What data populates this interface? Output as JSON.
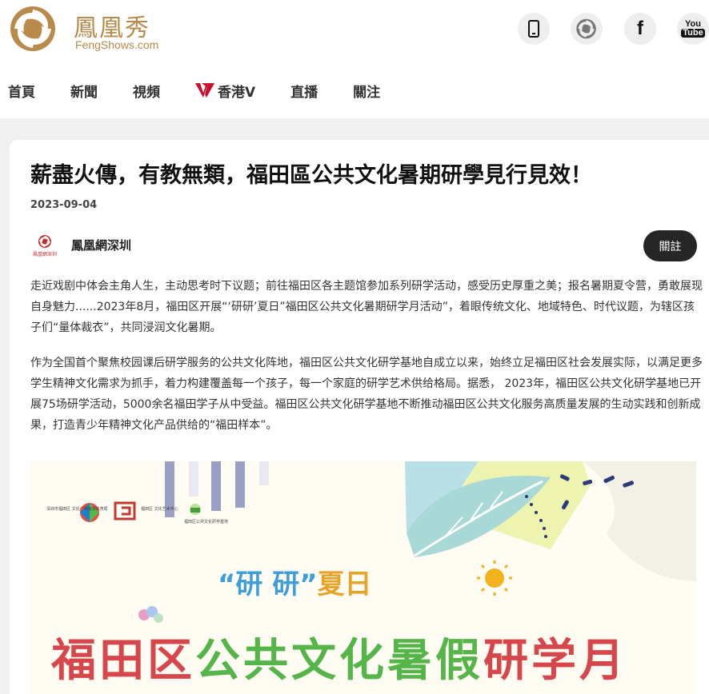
{
  "brand": {
    "name_cn": "鳳凰秀",
    "name_en": "FengShows.com",
    "color": "#b88a4c"
  },
  "social": [
    {
      "name": "mobile-icon"
    },
    {
      "name": "ifeng-icon"
    },
    {
      "name": "facebook-icon",
      "glyph": "f"
    },
    {
      "name": "youtube-icon",
      "line1": "You",
      "line2": "Tube"
    }
  ],
  "nav": {
    "items": [
      {
        "label": "首頁"
      },
      {
        "label": "新聞"
      },
      {
        "label": "視頻"
      },
      {
        "label": "香港V",
        "icon": "hkv-icon",
        "icon_color": "#c8102e"
      },
      {
        "label": "直播"
      },
      {
        "label": "關注"
      }
    ]
  },
  "article": {
    "title": "薪盡火傳，有教無類，福田區公共文化暑期研學見行見效！",
    "date": "2023-09-04",
    "author": {
      "name": "鳳凰網深圳",
      "logo_caption": "鳳凰網深圳"
    },
    "follow_label": "關註",
    "paragraphs": [
      "走近戏剧中体会主角人生，主动思考时下议题；前往福田区各主题馆参加系列研学活动，感受历史厚重之美；报名暑期夏令营，勇敢展现自身魅力......2023年8月，福田区开展“‘研研’夏日”福田区公共文化暑期研学月活动”，着眼传统文化、地域特色、时代议题，为辖区孩子们“量体裁衣”，共同浸润文化暑期。",
      "作为全国首个聚焦校园课后研学服务的公共文化阵地，福田区公共文化研学基地自成立以来，始终立足福田区社会发展实际，以满足更多学生精神文化需求为抓手，着力构建覆盖每一个孩子，每一个家庭的研学艺术供给格局。据悉， 2023年，福田区公共文化研学基地已开展75场研学活动，5000余名福田学子从中受益。福田区公共文化研学基地不断推动福田区公共文化服务高质量发展的生动实践和创新成果，打造青少年精神文化产品供给的“福田样本”。"
    ]
  },
  "hero": {
    "line1_quote_open": "“",
    "line1_part1": "研 研",
    "line1_quote_close": "”",
    "line1_part2": "夏日",
    "line2_red1": "福田区",
    "line2_green": "公共文化暑假",
    "line2_red2": "研学月",
    "partners": [
      {
        "label": "深圳市福田区 文化广电旅游体育局"
      },
      {
        "label": "福田区 文化艺术中心"
      },
      {
        "label": "福田区公共文化研学基地"
      }
    ],
    "colors": {
      "red": "#d6464a",
      "green": "#55b548",
      "blue": "#3f9ed8",
      "yellow": "#e8a42a"
    }
  }
}
